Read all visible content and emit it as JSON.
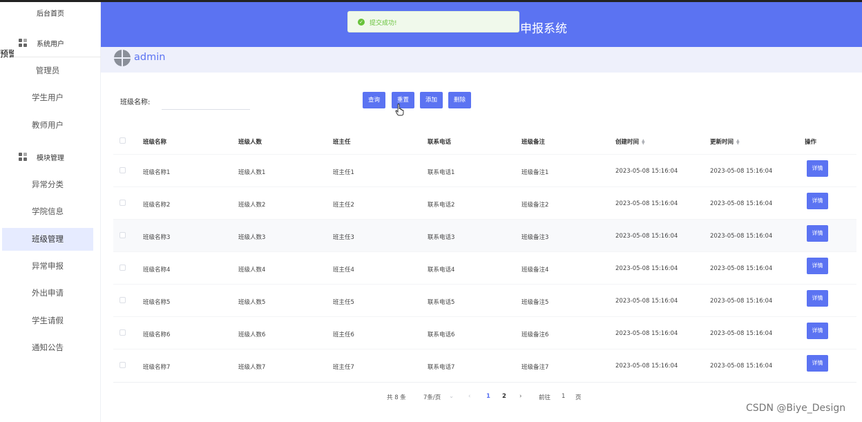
{
  "sidebar": {
    "home": "后台首页",
    "overflow_text": "预警",
    "group_users": {
      "label": "系统用户",
      "items": [
        "管理员",
        "学生用户",
        "教师用户"
      ]
    },
    "group_modules": {
      "label": "模块管理",
      "items": [
        "异常分类",
        "学院信息",
        "班级管理",
        "异常申报",
        "外出申请",
        "学生请假",
        "通知公告"
      ]
    },
    "active_item": "班级管理"
  },
  "header": {
    "title": "申报系统",
    "bg_color": "#5b73f2"
  },
  "toast": {
    "text": "提交成功!",
    "color": "#67c23a"
  },
  "user": {
    "name": "admin"
  },
  "search": {
    "label": "班级名称:",
    "value": ""
  },
  "buttons": {
    "query": "查询",
    "reset": "重置",
    "add": "添加",
    "delete": "删除"
  },
  "table": {
    "headers": {
      "name": "班级名称",
      "count": "班级人数",
      "teacher": "班主任",
      "phone": "联系电话",
      "note": "班级备注",
      "created": "创建时间",
      "updated": "更新时间",
      "ops": "操作"
    },
    "detail_label": "详情",
    "rows": [
      {
        "name": "班级名称1",
        "count": "班级人数1",
        "teacher": "班主任1",
        "phone": "联系电话1",
        "note": "班级备注1",
        "created": "2023-05-08 15:16:04",
        "updated": "2023-05-08 15:16:04"
      },
      {
        "name": "班级名称2",
        "count": "班级人数2",
        "teacher": "班主任2",
        "phone": "联系电话2",
        "note": "班级备注2",
        "created": "2023-05-08 15:16:04",
        "updated": "2023-05-08 15:16:04"
      },
      {
        "name": "班级名称3",
        "count": "班级人数3",
        "teacher": "班主任3",
        "phone": "联系电话3",
        "note": "班级备注3",
        "created": "2023-05-08 15:16:04",
        "updated": "2023-05-08 15:16:04"
      },
      {
        "name": "班级名称4",
        "count": "班级人数4",
        "teacher": "班主任4",
        "phone": "联系电话4",
        "note": "班级备注4",
        "created": "2023-05-08 15:16:04",
        "updated": "2023-05-08 15:16:04"
      },
      {
        "name": "班级名称5",
        "count": "班级人数5",
        "teacher": "班主任5",
        "phone": "联系电话5",
        "note": "班级备注5",
        "created": "2023-05-08 15:16:04",
        "updated": "2023-05-08 15:16:04"
      },
      {
        "name": "班级名称6",
        "count": "班级人数6",
        "teacher": "班主任6",
        "phone": "联系电话6",
        "note": "班级备注6",
        "created": "2023-05-08 15:16:04",
        "updated": "2023-05-08 15:16:04"
      },
      {
        "name": "班级名称7",
        "count": "班级人数7",
        "teacher": "班主任7",
        "phone": "联系电话7",
        "note": "班级备注7",
        "created": "2023-05-08 15:16:04",
        "updated": "2023-05-08 15:16:04"
      }
    ]
  },
  "pagination": {
    "total": "共 8 条",
    "page_size": "7条/页",
    "pages": [
      "1",
      "2"
    ],
    "current": "1",
    "goto_label": "前往",
    "goto_value": "1",
    "page_suffix": "页"
  },
  "watermark": "CSDN @Biye_Design"
}
